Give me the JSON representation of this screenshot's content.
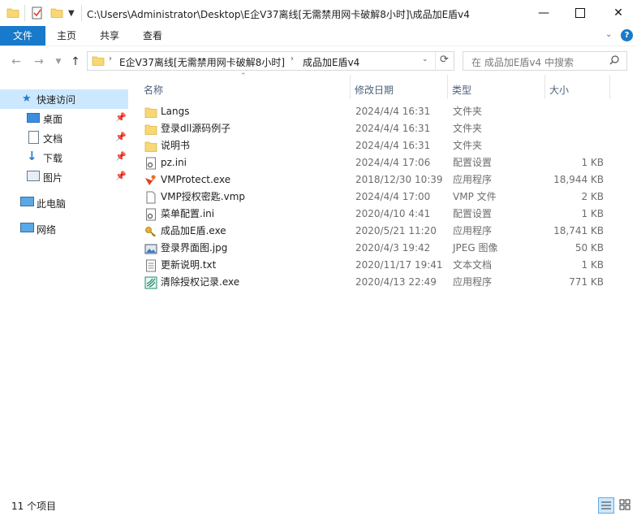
{
  "window": {
    "title": "C:\\Users\\Administrator\\Desktop\\E企V37离线[无需禁用网卡破解8小时]\\成品加E盾v4",
    "minimize_icon": "minimize-icon",
    "maximize_icon": "maximize-icon",
    "close_icon": "close-icon"
  },
  "ribbon": {
    "tabs": [
      "文件",
      "主页",
      "共享",
      "查看"
    ]
  },
  "address": {
    "segments": [
      "E企V37离线[无需禁用网卡破解8小时]",
      "成品加E盾v4"
    ],
    "search_placeholder": "在 成品加E盾v4 中搜索"
  },
  "nav": {
    "items": [
      {
        "label": "快速访问",
        "icon": "star-icon",
        "pinned": false,
        "selected": true
      },
      {
        "label": "桌面",
        "icon": "desktop-icon",
        "pinned": true
      },
      {
        "label": "文档",
        "icon": "document-icon",
        "pinned": true
      },
      {
        "label": "下载",
        "icon": "download-icon",
        "pinned": true
      },
      {
        "label": "图片",
        "icon": "picture-icon",
        "pinned": true
      },
      {
        "label": "此电脑",
        "icon": "computer-icon",
        "pinned": false
      },
      {
        "label": "网络",
        "icon": "network-icon",
        "pinned": false
      }
    ]
  },
  "columns": {
    "name": "名称",
    "date": "修改日期",
    "type": "类型",
    "size": "大小"
  },
  "files": [
    {
      "name": "Langs",
      "date": "2024/4/4 16:31",
      "type": "文件夹",
      "size": "",
      "icon": "folder-icon"
    },
    {
      "name": "登录dll源码例子",
      "date": "2024/4/4 16:31",
      "type": "文件夹",
      "size": "",
      "icon": "folder-icon"
    },
    {
      "name": "说明书",
      "date": "2024/4/4 16:31",
      "type": "文件夹",
      "size": "",
      "icon": "folder-icon"
    },
    {
      "name": "pz.ini",
      "date": "2024/4/4 17:06",
      "type": "配置设置",
      "size": "1 KB",
      "icon": "settings-file-icon"
    },
    {
      "name": "VMProtect.exe",
      "date": "2018/12/30 10:39",
      "type": "应用程序",
      "size": "18,944 KB",
      "icon": "vmprotect-icon"
    },
    {
      "name": "VMP授权密匙.vmp",
      "date": "2024/4/4 17:00",
      "type": "VMP 文件",
      "size": "2 KB",
      "icon": "blank-file-icon"
    },
    {
      "name": "菜单配置.ini",
      "date": "2020/4/10 4:41",
      "type": "配置设置",
      "size": "1 KB",
      "icon": "settings-file-icon"
    },
    {
      "name": "成品加E盾.exe",
      "date": "2020/5/21 11:20",
      "type": "应用程序",
      "size": "18,741 KB",
      "icon": "key-icon"
    },
    {
      "name": "登录界面图.jpg",
      "date": "2020/4/3 19:42",
      "type": "JPEG 图像",
      "size": "50 KB",
      "icon": "image-file-icon"
    },
    {
      "name": "更新说明.txt",
      "date": "2020/11/17 19:41",
      "type": "文本文档",
      "size": "1 KB",
      "icon": "text-file-icon"
    },
    {
      "name": "清除授权记录.exe",
      "date": "2020/4/13 22:49",
      "type": "应用程序",
      "size": "771 KB",
      "icon": "app-icon"
    }
  ],
  "status": {
    "item_count": "11 个项目"
  },
  "colors": {
    "accent": "#1979ca",
    "nav_selected": "#cce8ff",
    "folder": "#f8d775"
  }
}
